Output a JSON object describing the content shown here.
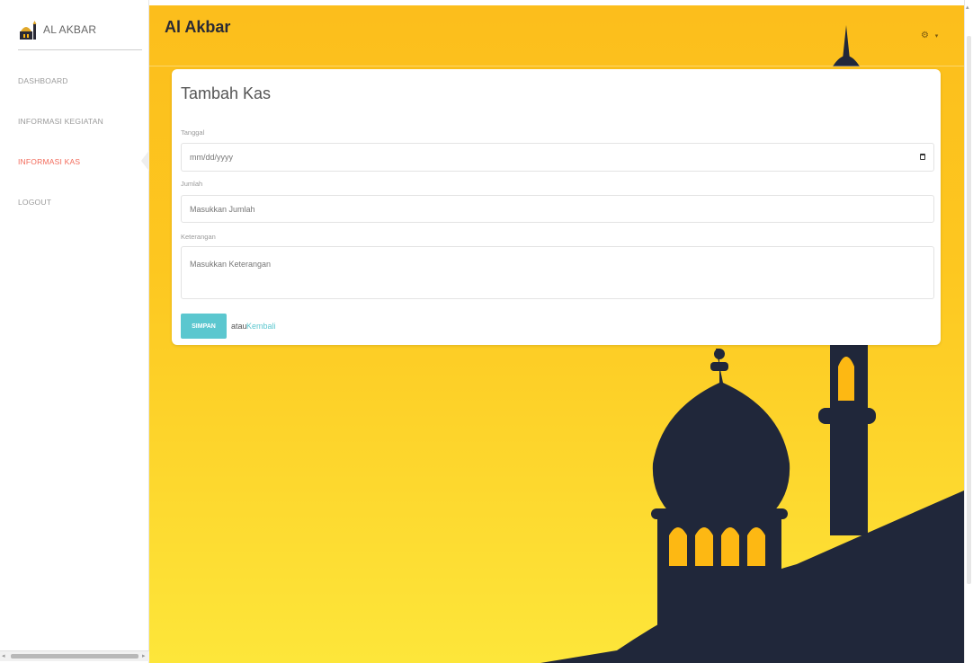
{
  "brand": {
    "name": "AL AKBAR",
    "logo_icon": "mosque-logo-icon"
  },
  "sidebar": {
    "items": [
      {
        "label": "DASHBOARD",
        "active": false
      },
      {
        "label": "INFORMASI KEGIATAN",
        "active": false
      },
      {
        "label": "INFORMASI KAS",
        "active": true
      },
      {
        "label": "LOGOUT",
        "active": false
      }
    ]
  },
  "header": {
    "title": "Al Akbar",
    "settings_icon": "gear-icon",
    "settings_caret": "▾"
  },
  "form": {
    "title": "Tambah Kas",
    "tanggal": {
      "label": "Tanggal",
      "placeholder": "mm/dd/yyyy",
      "icon": "calendar-icon"
    },
    "jumlah": {
      "label": "Jumlah",
      "placeholder": "Masukkan Jumlah"
    },
    "keterangan": {
      "label": "Keterangan",
      "placeholder": "Masukkan Keterangan"
    },
    "save_label": "SIMPAN",
    "or_text": "atau",
    "back_label": "Kembali"
  },
  "colors": {
    "accent": "#5bc7cf",
    "active_nav": "#f26a5a",
    "background_top": "#fcbe1c",
    "background_bottom": "#fde63a",
    "silhouette": "#20273a",
    "window_glow": "#fdb813"
  }
}
